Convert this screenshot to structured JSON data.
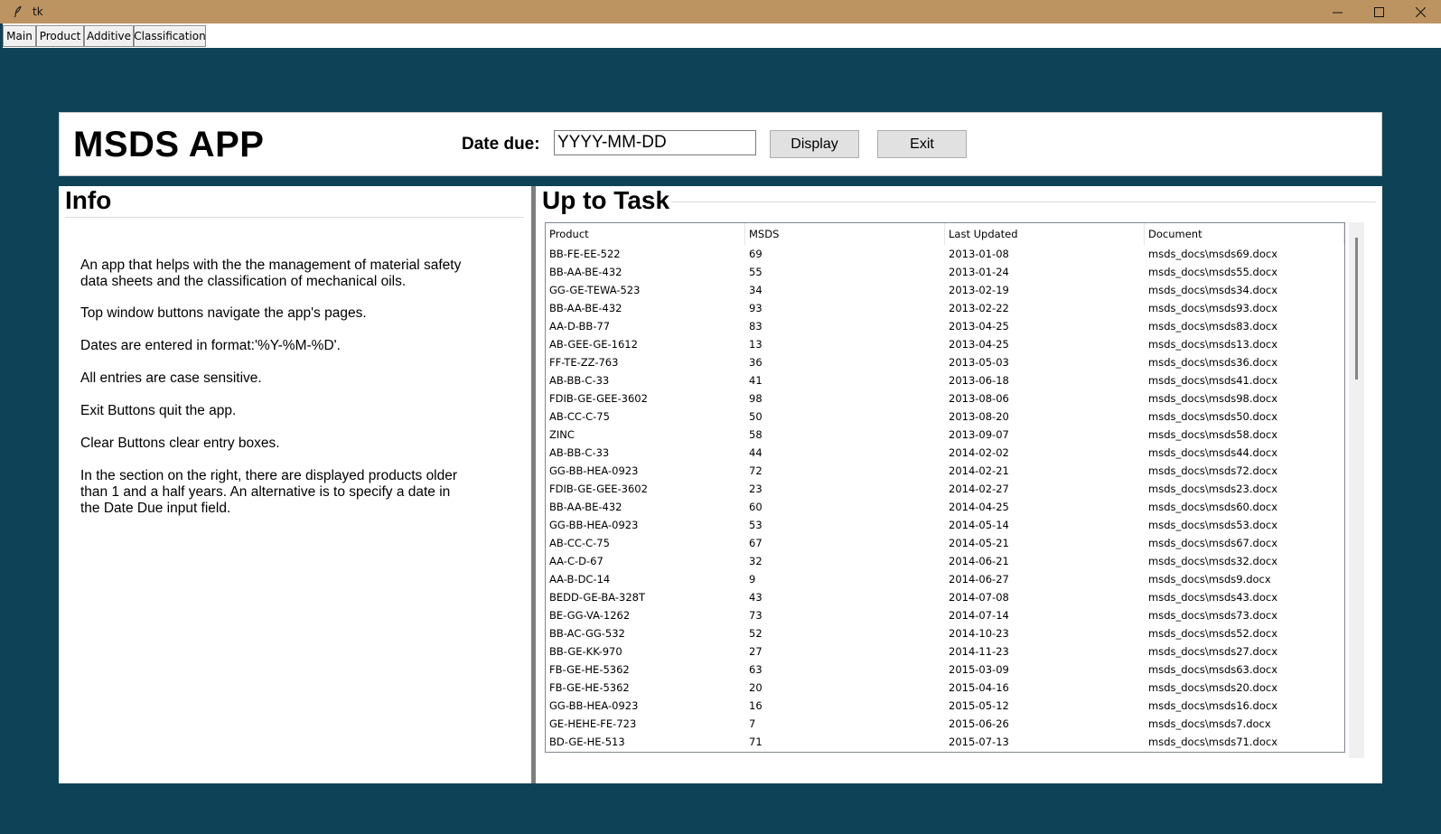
{
  "window": {
    "title": "tk"
  },
  "nav": {
    "main": "Main",
    "product": "Product",
    "additive": "Additive",
    "classification": "Classification"
  },
  "header": {
    "app_title": "MSDS APP",
    "date_label": "Date due:",
    "date_placeholder": "YYYY-MM-DD",
    "display_label": "Display",
    "exit_label": "Exit"
  },
  "info": {
    "title": "Info",
    "paragraphs": [
      "An app that helps with the the management of material safety data sheets and the classification of mechanical oils.",
      "Top window buttons navigate the app's pages.",
      "Dates are entered in format:'%Y-%M-%D'.",
      "All entries are case sensitive.",
      "Exit Buttons quit the app.",
      "Clear Buttons clear entry boxes.",
      "In the section on the right, there are displayed products older than 1 and a half years. An alternative is to specify a date in the Date Due input field."
    ]
  },
  "task": {
    "title": "Up to Task",
    "columns": [
      "Product",
      "MSDS",
      "Last Updated",
      "Document"
    ],
    "rows": [
      [
        "BB-FE-EE-522",
        "69",
        "2013-01-08",
        "msds_docs\\msds69.docx"
      ],
      [
        "BB-AA-BE-432",
        "55",
        "2013-01-24",
        "msds_docs\\msds55.docx"
      ],
      [
        "GG-GE-TEWA-523",
        "34",
        "2013-02-19",
        "msds_docs\\msds34.docx"
      ],
      [
        "BB-AA-BE-432",
        "93",
        "2013-02-22",
        "msds_docs\\msds93.docx"
      ],
      [
        "AA-D-BB-77",
        "83",
        "2013-04-25",
        "msds_docs\\msds83.docx"
      ],
      [
        "AB-GEE-GE-1612",
        "13",
        "2013-04-25",
        "msds_docs\\msds13.docx"
      ],
      [
        "FF-TE-ZZ-763",
        "36",
        "2013-05-03",
        "msds_docs\\msds36.docx"
      ],
      [
        "AB-BB-C-33",
        "41",
        "2013-06-18",
        "msds_docs\\msds41.docx"
      ],
      [
        "FDIB-GE-GEE-3602",
        "98",
        "2013-08-06",
        "msds_docs\\msds98.docx"
      ],
      [
        "AB-CC-C-75",
        "50",
        "2013-08-20",
        "msds_docs\\msds50.docx"
      ],
      [
        "ZINC",
        "58",
        "2013-09-07",
        "msds_docs\\msds58.docx"
      ],
      [
        "AB-BB-C-33",
        "44",
        "2014-02-02",
        "msds_docs\\msds44.docx"
      ],
      [
        "GG-BB-HEA-0923",
        "72",
        "2014-02-21",
        "msds_docs\\msds72.docx"
      ],
      [
        "FDIB-GE-GEE-3602",
        "23",
        "2014-02-27",
        "msds_docs\\msds23.docx"
      ],
      [
        "BB-AA-BE-432",
        "60",
        "2014-04-25",
        "msds_docs\\msds60.docx"
      ],
      [
        "GG-BB-HEA-0923",
        "53",
        "2014-05-14",
        "msds_docs\\msds53.docx"
      ],
      [
        "AB-CC-C-75",
        "67",
        "2014-05-21",
        "msds_docs\\msds67.docx"
      ],
      [
        "AA-C-D-67",
        "32",
        "2014-06-21",
        "msds_docs\\msds32.docx"
      ],
      [
        "AA-B-DC-14",
        "9",
        "2014-06-27",
        "msds_docs\\msds9.docx"
      ],
      [
        "BEDD-GE-BA-328T",
        "43",
        "2014-07-08",
        "msds_docs\\msds43.docx"
      ],
      [
        "BE-GG-VA-1262",
        "73",
        "2014-07-14",
        "msds_docs\\msds73.docx"
      ],
      [
        "BB-AC-GG-532",
        "52",
        "2014-10-23",
        "msds_docs\\msds52.docx"
      ],
      [
        "BB-GE-KK-970",
        "27",
        "2014-11-23",
        "msds_docs\\msds27.docx"
      ],
      [
        "FB-GE-HE-5362",
        "63",
        "2015-03-09",
        "msds_docs\\msds63.docx"
      ],
      [
        "FB-GE-HE-5362",
        "20",
        "2015-04-16",
        "msds_docs\\msds20.docx"
      ],
      [
        "GG-BB-HEA-0923",
        "16",
        "2015-05-12",
        "msds_docs\\msds16.docx"
      ],
      [
        "GE-HEHE-FE-723",
        "7",
        "2015-06-26",
        "msds_docs\\msds7.docx"
      ],
      [
        "BD-GE-HE-513",
        "71",
        "2015-07-13",
        "msds_docs\\msds71.docx"
      ]
    ]
  },
  "icons": {
    "app": "feather-icon",
    "minimize": "minimize-icon",
    "maximize": "maximize-icon",
    "close": "close-icon"
  },
  "colors": {
    "titlebar": "#bc9461",
    "background": "#0e4257"
  }
}
